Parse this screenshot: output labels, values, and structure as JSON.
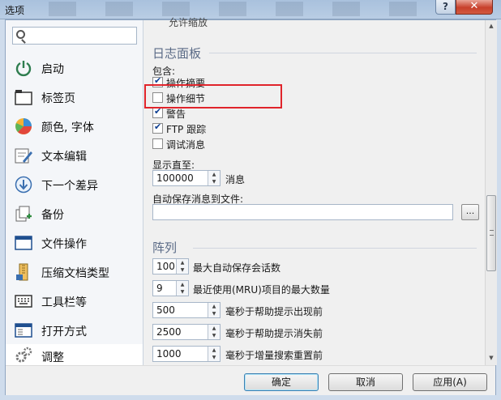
{
  "window": {
    "title": "选项",
    "help_label": "?",
    "close_label": "✕"
  },
  "sidebar": {
    "search_placeholder": "",
    "items": [
      {
        "label": "启动",
        "icon": "power-icon"
      },
      {
        "label": "标签页",
        "icon": "tabs-icon"
      },
      {
        "label": "颜色, 字体",
        "icon": "color-palette-icon"
      },
      {
        "label": "文本编辑",
        "icon": "text-edit-icon"
      },
      {
        "label": "下一个差异",
        "icon": "next-diff-icon"
      },
      {
        "label": "备份",
        "icon": "backup-icon"
      },
      {
        "label": "文件操作",
        "icon": "file-ops-icon"
      },
      {
        "label": "压缩文档类型",
        "icon": "archive-icon"
      },
      {
        "label": "工具栏等",
        "icon": "toolbar-icon"
      },
      {
        "label": "打开方式",
        "icon": "open-with-icon"
      },
      {
        "label": "调整",
        "icon": "gears-icon"
      }
    ]
  },
  "log_panel": {
    "partial_top": "允许缩放",
    "heading": "日志面板",
    "include_label": "包含:",
    "options": [
      {
        "label": "操作摘要",
        "checked": true
      },
      {
        "label": "操作细节",
        "checked": false
      },
      {
        "label": "警告",
        "checked": true
      },
      {
        "label": "FTP 跟踪",
        "checked": true
      },
      {
        "label": "调试消息",
        "checked": false
      }
    ],
    "show_until_label": "显示直至:",
    "show_until_value": "100000",
    "show_until_unit": "消息",
    "autosave_label": "自动保存消息到文件:",
    "autosave_value": "",
    "browse_label": "..."
  },
  "queue_panel": {
    "heading": "阵列",
    "rows": [
      {
        "value": "100",
        "label": "最大自动保存会话数"
      },
      {
        "value": "9",
        "label": "最近使用(MRU)项目的最大数量"
      },
      {
        "value": "500",
        "label": "毫秒于帮助提示出现前"
      },
      {
        "value": "2500",
        "label": "毫秒于帮助提示消失前"
      },
      {
        "value": "1000",
        "label": "毫秒于增量搜索重置前"
      }
    ]
  },
  "footer": {
    "ok_label": "确定",
    "cancel_label": "取消",
    "apply_label": "应用(A)"
  },
  "colors": {
    "highlight": "#e0242b",
    "accent": "#3c7fb1"
  }
}
